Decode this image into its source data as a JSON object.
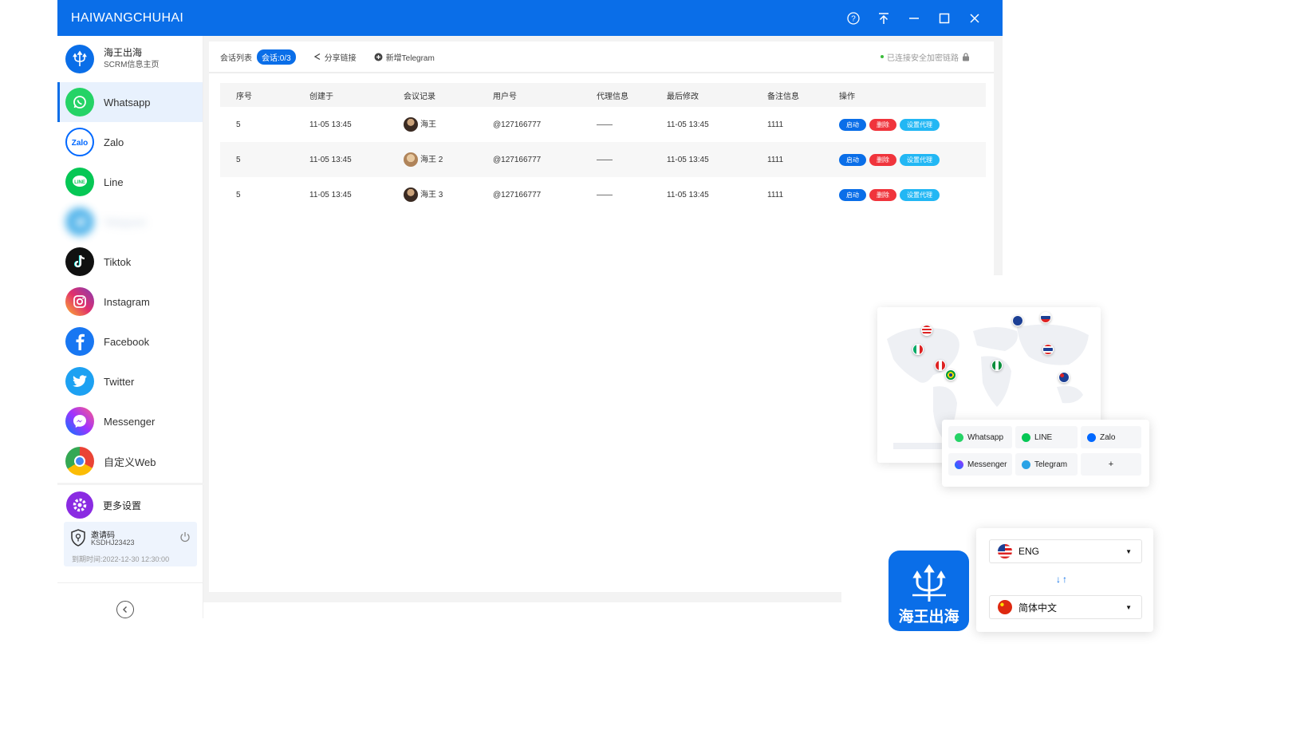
{
  "window": {
    "title": "HAIWANGCHUHAI"
  },
  "brand": {
    "name": "海王出海",
    "subtitle": "SCRM信息主页"
  },
  "sidebar": {
    "items": [
      {
        "label": "Whatsapp",
        "color": "#25d366",
        "icon": "whatsapp-icon"
      },
      {
        "label": "Zalo",
        "color": "#0068ff",
        "icon": "zalo-icon"
      },
      {
        "label": "Line",
        "color": "#06c755",
        "icon": "line-icon"
      },
      {
        "label": "Telegram",
        "color": "#2aa3e6",
        "icon": "telegram-icon"
      },
      {
        "label": "Tiktok",
        "color": "#111111",
        "icon": "tiktok-icon"
      },
      {
        "label": "Instagram",
        "color": "#d6249f",
        "icon": "instagram-icon"
      },
      {
        "label": "Facebook",
        "color": "#1877f2",
        "icon": "facebook-icon"
      },
      {
        "label": "Twitter",
        "color": "#1da1f2",
        "icon": "twitter-icon"
      },
      {
        "label": "Messenger",
        "color": "#7b3cf0",
        "icon": "messenger-icon"
      },
      {
        "label": "自定义Web",
        "color": "#4285f4",
        "icon": "chrome-icon"
      }
    ],
    "settings_label": "更多设置",
    "invite": {
      "title": "邀请码",
      "code": "KSDHJ23423",
      "expiry": "到期时间:2022-12-30 12:30:00"
    }
  },
  "toolbar": {
    "list_label": "会话列表",
    "session_badge": "会话:0/3",
    "share_label": "分享链接",
    "add_label": "新增Telegram",
    "secure_label": "已连接安全加密链路"
  },
  "table": {
    "headers": [
      "序号",
      "创建于",
      "会议记录",
      "用户号",
      "代理信息",
      "最后修改",
      "备注信息",
      "操作"
    ],
    "rows": [
      {
        "no": "5",
        "created": "11-05 13:45",
        "name": "海王",
        "user": "@127166777",
        "proxy": "——",
        "modified": "11-05 13:45",
        "note": "1111"
      },
      {
        "no": "5",
        "created": "11-05 13:45",
        "name": "海王 2",
        "user": "@127166777",
        "proxy": "——",
        "modified": "11-05 13:45",
        "note": "1111"
      },
      {
        "no": "5",
        "created": "11-05 13:45",
        "name": "海王 3",
        "user": "@127166777",
        "proxy": "——",
        "modified": "11-05 13:45",
        "note": "1111"
      }
    ],
    "actions": {
      "start": "启动",
      "delete": "删除",
      "proxy": "设置代理"
    }
  },
  "apps_card": {
    "items": [
      "Whatsapp",
      "LINE",
      "Zalo",
      "Messenger",
      "Telegram",
      "+"
    ]
  },
  "language": {
    "from": "ENG",
    "to": "简体中文"
  },
  "app_logo_name": "海王出海"
}
